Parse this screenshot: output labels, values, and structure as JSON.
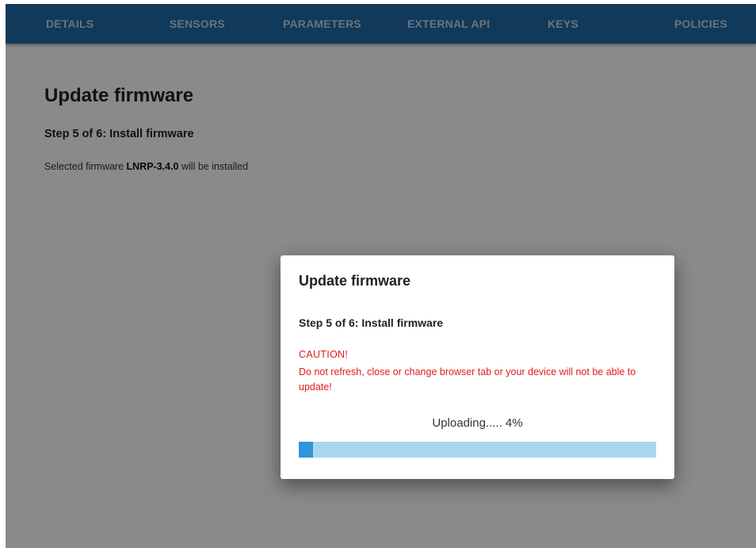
{
  "tabs": [
    {
      "label": "DETAILS"
    },
    {
      "label": "SENSORS"
    },
    {
      "label": "PARAMETERS"
    },
    {
      "label": "EXTERNAL API"
    },
    {
      "label": "KEYS"
    },
    {
      "label": "POLICIES"
    }
  ],
  "page": {
    "title": "Update firmware",
    "step": "Step 5 of 6: Install firmware",
    "description_prefix": "Selected firmware ",
    "firmware_name": "LNRP-3.4.0",
    "description_suffix": " will be installed"
  },
  "dialog": {
    "title": "Update firmware",
    "step": "Step 5 of 6: Install firmware",
    "caution_heading": "CAUTION!",
    "caution_text": "Do not refresh, close or change browser tab or your device will not be able to update!",
    "progress_label": "Uploading..... 4%",
    "progress_percent": 4
  },
  "colors": {
    "tabbar": "#1f6aa6",
    "caution": "#e21b1b",
    "progress_track": "#a8d6f1",
    "progress_fill": "#3295da"
  }
}
